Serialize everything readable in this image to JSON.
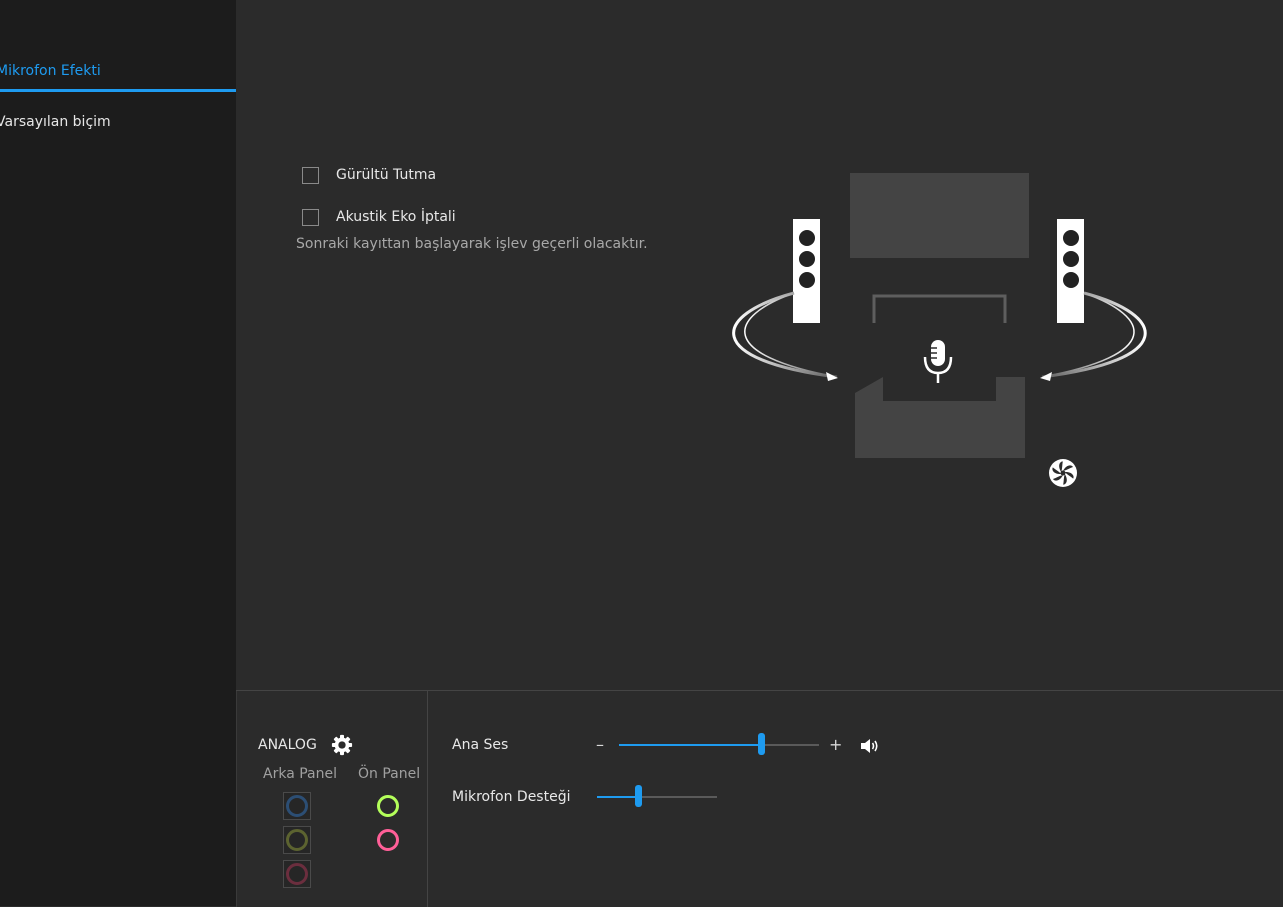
{
  "sidebar": {
    "items": [
      {
        "label": "Mikrofon Efekti",
        "active": true
      },
      {
        "label": "Varsayılan biçim",
        "active": false
      }
    ]
  },
  "effects": {
    "noise_suppression_label": "Gürültü Tutma",
    "echo_cancellation_label": "Akustik Eko İptali",
    "note": "Sonraki kayıttan başlayarak işlev geçerli olacaktır."
  },
  "footer": {
    "analog_title": "ANALOG",
    "rear_panel_label": "Arka Panel",
    "front_panel_label": "Ön Panel",
    "master_volume_label": "Ana Ses",
    "minus_symbol": "–",
    "plus_symbol": "+",
    "master_volume_level": 0.71,
    "mic_boost_label": "Mikrofon Desteği",
    "mic_boost_level": 0.34
  },
  "colors": {
    "accent": "#1e9bf0",
    "jack_rear_blue": "#2c4e74",
    "jack_rear_olive": "#5c6330",
    "jack_rear_red": "#6b2e3e",
    "jack_front_green": "#b4ff5a",
    "jack_front_pink": "#ff5f98"
  }
}
